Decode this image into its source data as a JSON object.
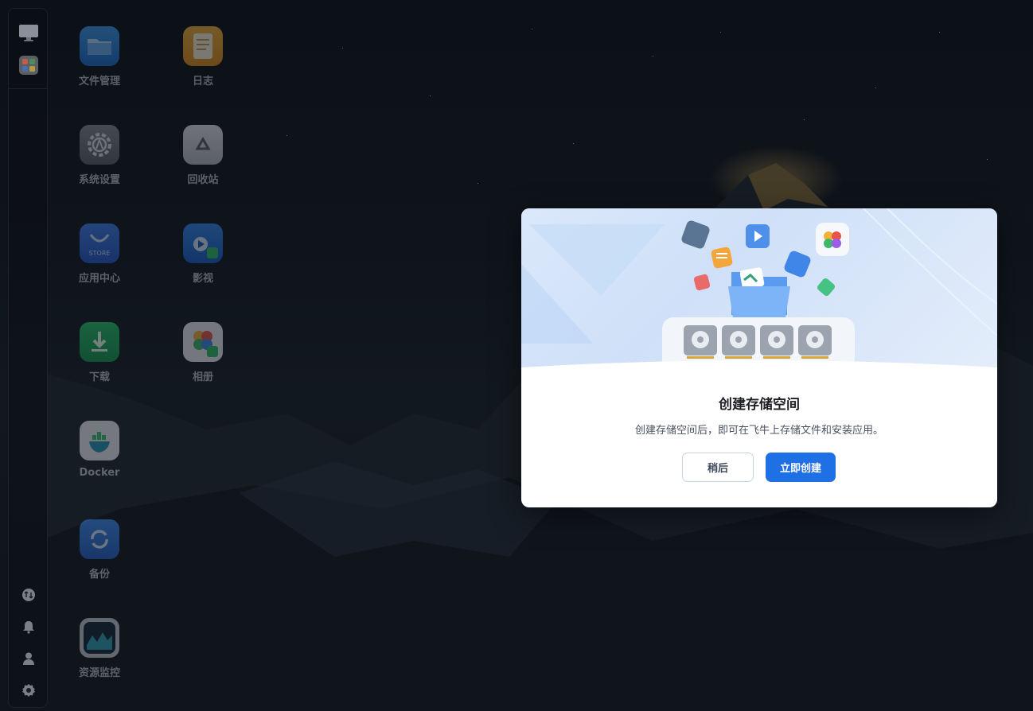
{
  "desktop": {
    "icons": [
      {
        "label": "文件管理",
        "icon": "folder-icon"
      },
      {
        "label": "日志",
        "icon": "log-icon"
      },
      {
        "label": "系统设置",
        "icon": "settings-icon"
      },
      {
        "label": "回收站",
        "icon": "recycle-bin-icon"
      },
      {
        "label": "应用中心",
        "icon": "app-store-icon"
      },
      {
        "label": "影视",
        "icon": "video-icon"
      },
      {
        "label": "下载",
        "icon": "download-icon"
      },
      {
        "label": "相册",
        "icon": "photos-icon"
      },
      {
        "label": "Docker",
        "icon": "docker-icon"
      },
      {
        "label": "备份",
        "icon": "backup-icon"
      },
      {
        "label": "资源监控",
        "icon": "resource-monitor-icon"
      }
    ],
    "store_badge": "STORE"
  },
  "sidebar": {
    "top": [
      "monitor-icon",
      "apps-grid-icon"
    ],
    "bottom": [
      "upload-download-icon",
      "bell-icon",
      "user-icon",
      "gear-icon"
    ]
  },
  "dialog": {
    "title": "创建存储空间",
    "description": "创建存储空间后，即可在飞牛上存储文件和安装应用。",
    "later_label": "稍后",
    "create_label": "立即创建"
  },
  "colors": {
    "primary": "#1f6fe5",
    "dialog_bg": "#ffffff",
    "hero_bg": "#d6e5fa"
  }
}
